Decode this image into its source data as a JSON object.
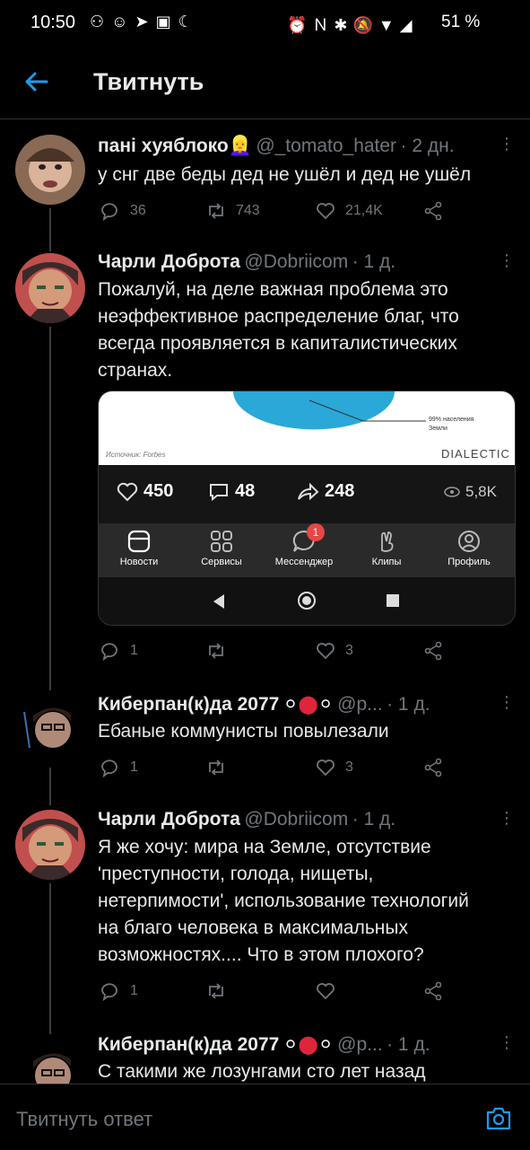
{
  "status_bar": {
    "time": "10:50",
    "battery": "51 %"
  },
  "header": {
    "title": "Твитнуть"
  },
  "tweets": [
    {
      "name": "пані хуяблоко👱‍♀️",
      "handle": "@_tomato_hater",
      "time": "· 2 дн.",
      "text": "у снг две беды дед не ушёл и дед не ушёл",
      "replies": "36",
      "retweets": "743",
      "likes": "21,4K"
    },
    {
      "name": "Чарли Доброта",
      "handle": "@Dobriicom",
      "time": "· 1 д.",
      "text_lines": [
        "Пожалуй, на деле важная проблема это",
        "неэффективное распределение благ, что",
        "всегда проявляется в капиталистических",
        "странах."
      ],
      "replies": "1",
      "retweets": "",
      "likes": "3",
      "card": {
        "chart_label_1": "99% населения",
        "chart_label_2": "Земли",
        "source": "Источник: Forbes",
        "brand": "DIALECTIC",
        "likes": "450",
        "comments": "48",
        "shares": "248",
        "views": "5,8K",
        "nav": [
          "Новости",
          "Сервисы",
          "Мессенджер",
          "Клипы",
          "Профиль"
        ],
        "badge": "1"
      }
    },
    {
      "name": "Киберпан(к)да 2077",
      "handle": "@p...",
      "time": "· 1 д.",
      "text": "Ебаные коммунисты повылезали",
      "replies": "1",
      "retweets": "",
      "likes": "3"
    },
    {
      "name": "Чарли Доброта",
      "handle": "@Dobriicom",
      "time": "· 1 д.",
      "text_lines": [
        "Я же хочу: мира на Земле, отсутствие",
        "'преступности, голода, нищеты,",
        "нетерпимости', использование технологий",
        "на благо человека в максимальных",
        "возможностях.... Что в этом плохого?"
      ],
      "replies": "1",
      "retweets": "",
      "likes": ""
    },
    {
      "name": "Киберпан(к)да 2077",
      "handle": "@p...",
      "time": "· 1 д.",
      "text": "С такими же лозунгами сто лет назад"
    }
  ],
  "reply": {
    "placeholder": "Твитнуть ответ"
  },
  "colors": {
    "accent": "#1d9bf0",
    "muted": "#71767b",
    "background": "#000000"
  }
}
